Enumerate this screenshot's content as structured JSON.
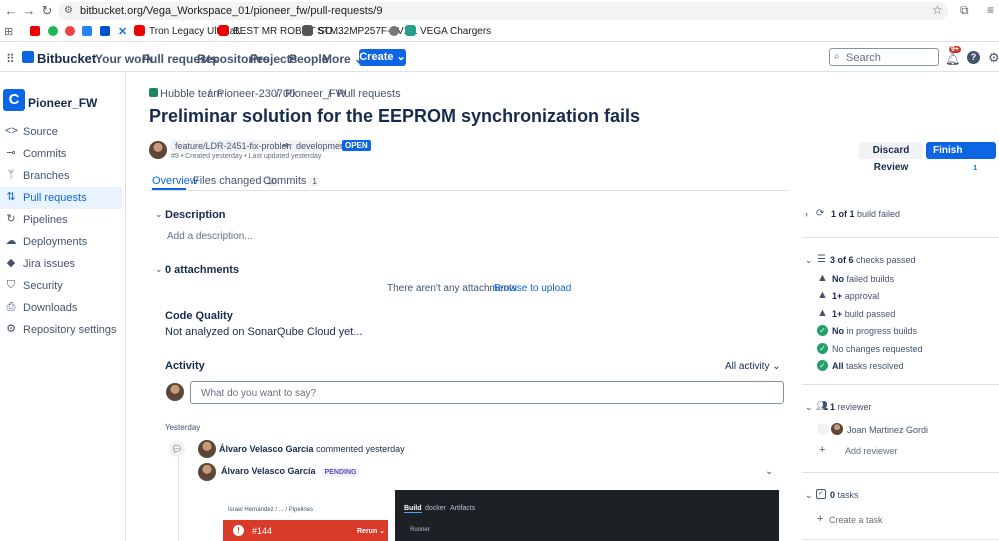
{
  "browser": {
    "url": "bitbucket.org/Vega_Workspace_01/pioneer_fw/pull-requests/9",
    "bookmarks": [
      {
        "label": "Tron Legacy Ultimat...",
        "color": "#c00"
      },
      {
        "label": "BEST MR ROBOT SO...",
        "color": "#c00"
      },
      {
        "label": "STM32MP257F-EV1...",
        "color": "#555"
      },
      {
        "label": "VEGA Chargers",
        "color": "#2a9d8f"
      }
    ]
  },
  "topnav": {
    "logo": "Bitbucket",
    "items": [
      "Your work",
      "Pull requests",
      "Repositories",
      "Projects",
      "People",
      "More"
    ],
    "create": "Create",
    "search_placeholder": "Search",
    "notif_badge": "9+"
  },
  "sidebar": {
    "repo_initial": "C",
    "repo_name": "Pioneer_FW",
    "items": [
      {
        "label": "Source",
        "icon": "code-icon"
      },
      {
        "label": "Commits",
        "icon": "commit-icon"
      },
      {
        "label": "Branches",
        "icon": "branch-icon"
      },
      {
        "label": "Pull requests",
        "icon": "pull-request-icon"
      },
      {
        "label": "Pipelines",
        "icon": "pipeline-icon"
      },
      {
        "label": "Deployments",
        "icon": "cloud-icon"
      },
      {
        "label": "Jira issues",
        "icon": "jira-icon"
      },
      {
        "label": "Security",
        "icon": "shield-icon"
      },
      {
        "label": "Downloads",
        "icon": "download-icon"
      },
      {
        "label": "Repository settings",
        "icon": "gear-icon"
      }
    ]
  },
  "breadcrumb": [
    "Hubble team",
    "Pioneer-230700",
    "Pioneer_FW",
    "Pull requests"
  ],
  "pr": {
    "title": "Preliminar solution for the EEPROM synchronization fails",
    "source_branch": "feature/LDR-2451-fix-problems...",
    "target_branch": "development",
    "status": "OPEN",
    "meta": "#9 • Created yesterday • Last updated yesterday",
    "discard": "Discard Review",
    "finish": "Finish Review",
    "finish_count": "1"
  },
  "tabs": [
    {
      "label": "Overview",
      "count": ""
    },
    {
      "label": "Files changed",
      "count": "10"
    },
    {
      "label": "Commits",
      "count": "1"
    }
  ],
  "description": {
    "heading": "Description",
    "placeholder": "Add a description..."
  },
  "attachments": {
    "heading": "0 attachments",
    "empty": "There aren't any attachments.",
    "upload": "Browse to upload"
  },
  "code_quality": {
    "heading": "Code Quality",
    "text": "Not analyzed on SonarQube Cloud yet..."
  },
  "activity": {
    "heading": "Activity",
    "filter": "All activity",
    "comment_placeholder": "What do you want to say?",
    "day": "Yesterday",
    "entry1_user": "Álvaro Velasco García",
    "entry1_action": "commented",
    "entry1_time": "yesterday",
    "entry2_user": "Álvaro Velasco García",
    "entry2_badge": "PENDING"
  },
  "screenshot1": {
    "crumb": "Israel Hernández / ... / Pipelines",
    "run": "#144",
    "rerun": "Rerun"
  },
  "screenshot2": {
    "tabs": [
      "Build",
      "docker",
      "Artifacts"
    ],
    "line": "Runner"
  },
  "right_panel": {
    "builds": {
      "bold": "1 of 1",
      "text": "build failed"
    },
    "checks": {
      "bold": "3 of 6",
      "text": "checks passed"
    },
    "check_items": [
      {
        "bold": "No",
        "text": "failed builds",
        "state": "warn"
      },
      {
        "bold": "1+",
        "text": "approval",
        "state": "warn"
      },
      {
        "bold": "1+",
        "text": "build passed",
        "state": "warn"
      },
      {
        "bold": "No",
        "text": "in progress builds",
        "state": "ok"
      },
      {
        "bold": "",
        "text": "No changes requested",
        "state": "ok"
      },
      {
        "bold": "All",
        "text": "tasks resolved",
        "state": "ok"
      }
    ],
    "reviewers": {
      "bold": "1",
      "text": "reviewer",
      "name": "Joan Martinez Gordi",
      "add": "Add reviewer"
    },
    "tasks": {
      "bold": "0",
      "text": "tasks",
      "add": "Create a task"
    }
  }
}
